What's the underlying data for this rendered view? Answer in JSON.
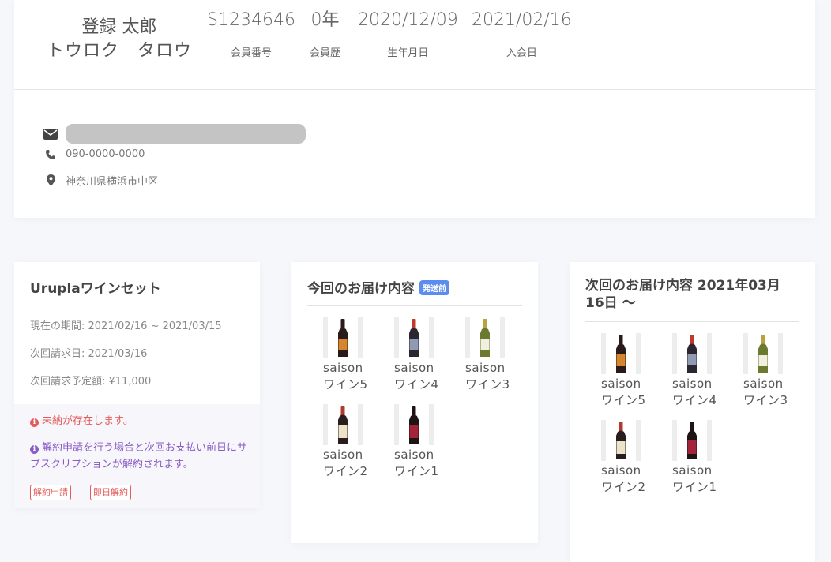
{
  "profile": {
    "name_kanji": "登録 太郎",
    "name_kana": "トウロク　タロウ",
    "stats": [
      {
        "value": "S1234646",
        "label": "会員番号"
      },
      {
        "value": "0年",
        "label": "会員歴"
      },
      {
        "value": "2020/12/09",
        "label": "生年月日"
      },
      {
        "value": "2021/02/16",
        "label": "入会日"
      }
    ],
    "contact": {
      "email_icon": "envelope-icon",
      "phone_icon": "phone-icon",
      "phone": "090-0000-0000",
      "address_icon": "map-marker-icon",
      "address": "神奈川県横浜市中区"
    }
  },
  "subscription": {
    "title": "Uruplaワインセット",
    "period": "現在の期間: 2021/02/16 ~ 2021/03/15",
    "next_billing": "次回請求日: 2021/03/16",
    "next_amount": "次回請求予定額: ¥11,000",
    "alert_unpaid": "未納が存在します。",
    "alert_cancel": "解約申請を行う場合と次回お支払い前日にサブスクリプションが解約されます。",
    "button_cancel_request": "解約申請",
    "button_immediate_cancel": "即日解約",
    "colors": {
      "alert_red": "#e45b5b",
      "alert_purple": "#8a5cc6"
    }
  },
  "current_delivery": {
    "title": "今回のお届け内容",
    "badge": "発送前",
    "badge_color": "#5b8def",
    "items": [
      {
        "name": "saison ワイン5",
        "bottle": "orange-label-red-wine"
      },
      {
        "name": "saison ワイン4",
        "bottle": "blue-label-red-wine"
      },
      {
        "name": "saison ワイン3",
        "bottle": "green-white-wine"
      },
      {
        "name": "saison ワイン2",
        "bottle": "cream-label-red-wine"
      },
      {
        "name": "saison ワイン1",
        "bottle": "red-label-wine"
      }
    ]
  },
  "next_delivery": {
    "title": "次回のお届け内容 2021年03月16日 〜",
    "items": [
      {
        "name": "saison ワイン5",
        "bottle": "orange-label-red-wine"
      },
      {
        "name": "saison ワイン4",
        "bottle": "blue-label-red-wine"
      },
      {
        "name": "saison ワイン3",
        "bottle": "green-white-wine"
      },
      {
        "name": "saison ワイン2",
        "bottle": "cream-label-red-wine"
      },
      {
        "name": "saison ワイン1",
        "bottle": "red-label-wine"
      }
    ]
  }
}
